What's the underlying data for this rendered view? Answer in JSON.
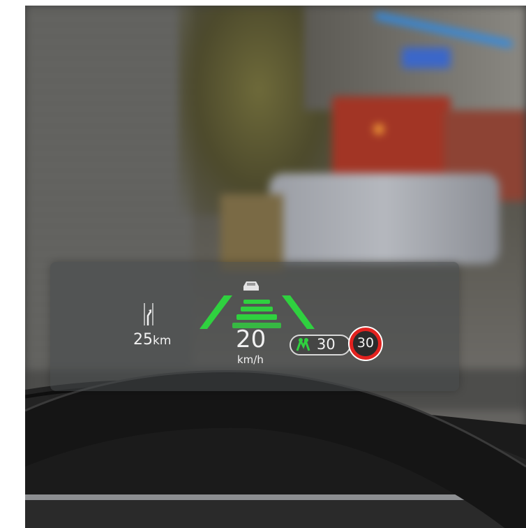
{
  "hud": {
    "route_distance_value": "25",
    "route_distance_unit": "km",
    "speed_value": "20",
    "speed_unit": "km/h",
    "set_speed_value": "30",
    "speed_limit_value": "30"
  },
  "colors": {
    "hud_text": "#f1f1f1",
    "lane_green": "#2fd13f",
    "limit_red": "#e2221f"
  },
  "icons": {
    "route": "turn-right-arrow-icon",
    "vehicle": "car-ahead-icon",
    "assist": "speed-assist-icon"
  }
}
